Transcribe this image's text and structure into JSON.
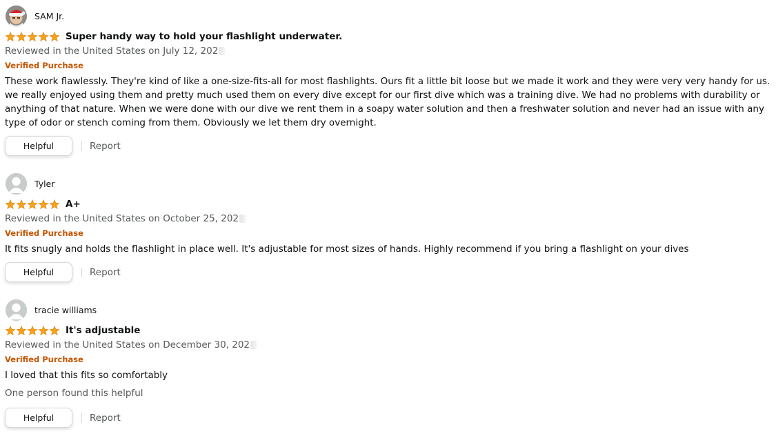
{
  "colors": {
    "star": "#f8a11b",
    "verified": "#c45500",
    "muted_text": "#565959",
    "text": "#0f1111",
    "button_border": "#d5d9d9"
  },
  "reviews": [
    {
      "author": "SAM Jr.",
      "avatar": "santa-hat-avatar",
      "rating": 5,
      "title": "Super handy way to hold your flashlight underwater.",
      "date": "Reviewed in the United States on July 12, 202",
      "verified": "Verified Purchase",
      "body": "These work flawlessly. They're kind of like a one-size-fits-all for most flashlights. Ours fit a little bit loose but we made it work and they were very very handy for us. we really enjoyed using them and pretty much used them on every dive except for our first dive which was a training dive. We had no problems with durability or anything of that nature. When we were done with our dive we rent them in a soapy water solution and then a freshwater solution and never had an issue with any type of odor or stench coming from them. Obviously we let them dry overnight.",
      "helpful_label": "Helpful",
      "report_label": "Report"
    },
    {
      "author": "Tyler",
      "avatar": "default-avatar",
      "rating": 5,
      "title": "A+",
      "date": "Reviewed in the United States on October 25, 202",
      "verified": "Verified Purchase",
      "body": "It fits snugly and holds the flashlight in place well. It's adjustable for most sizes of hands. Highly recommend if you bring a flashlight on your dives",
      "helpful_label": "Helpful",
      "report_label": "Report"
    },
    {
      "author": "tracie williams",
      "avatar": "default-avatar",
      "rating": 5,
      "title": "It's adjustable",
      "date": "Reviewed in the United States on December 30, 202",
      "verified": "Verified Purchase",
      "body": "I loved that this fits so comfortably",
      "found_helpful": "One person found this helpful",
      "helpful_label": "Helpful",
      "report_label": "Report"
    }
  ]
}
